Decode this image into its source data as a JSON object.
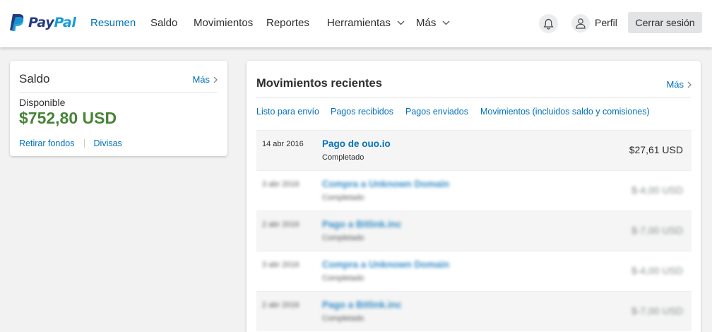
{
  "brand": {
    "logo_pay": "Pay",
    "logo_pal": "Pal",
    "primary_color": "#0070ba",
    "dark_blue": "#253b80",
    "light_blue": "#179bd7",
    "balance_green": "#478436"
  },
  "nav": {
    "items": [
      {
        "label": "Resumen",
        "active": true
      },
      {
        "label": "Saldo"
      },
      {
        "label": "Movimientos"
      },
      {
        "label": "Reportes"
      },
      {
        "label": "Herramientas",
        "dropdown": true
      },
      {
        "label": "Más",
        "dropdown": true
      }
    ],
    "notifications_icon": "bell-icon",
    "profile_icon": "user-icon",
    "profile_label": "Perfil",
    "logout_label": "Cerrar sesión"
  },
  "balance": {
    "title": "Saldo",
    "more_label": "Más",
    "available_label": "Disponible",
    "amount": "$752,80 USD",
    "links": [
      "Retirar fondos",
      "Divisas"
    ]
  },
  "movements": {
    "title": "Movimientos recientes",
    "more_label": "Más",
    "filters": [
      "Listo para envío",
      "Pagos recibidos",
      "Pagos enviados",
      "Movimientos (incluidos saldo y comisiones)"
    ],
    "rows": [
      {
        "date": "14 abr 2016",
        "description": "Pago de ouo.io",
        "status": "Completado",
        "amount": "$27,61 USD",
        "blurred": false
      },
      {
        "date": "3 abr 2016",
        "description": "Compra a Unknown Domain",
        "status": "Completado",
        "amount": "$-4,00 USD",
        "blurred": true
      },
      {
        "date": "2 abr 2016",
        "description": "Pago a Bitlink.inc",
        "status": "Completado",
        "amount": "$-7,00 USD",
        "blurred": true
      },
      {
        "date": "3 abr 2016",
        "description": "Compra a Unknown Domain",
        "status": "Completado",
        "amount": "$-4,00 USD",
        "blurred": true
      },
      {
        "date": "2 abr 2016",
        "description": "Pago a Bitlink.inc",
        "status": "Completado",
        "amount": "$-7,00 USD",
        "blurred": true
      }
    ]
  }
}
